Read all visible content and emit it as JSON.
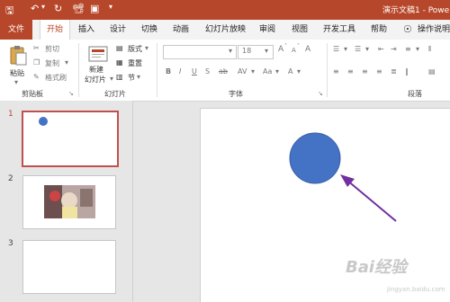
{
  "app": {
    "title": "演示文稿1 - Powe",
    "accent": "#b7472a"
  },
  "tabs": [
    {
      "label": "文件"
    },
    {
      "label": "开始"
    },
    {
      "label": "插入"
    },
    {
      "label": "设计"
    },
    {
      "label": "切换"
    },
    {
      "label": "动画"
    },
    {
      "label": "幻灯片放映"
    },
    {
      "label": "审阅"
    },
    {
      "label": "视图"
    },
    {
      "label": "开发工具"
    },
    {
      "label": "帮助"
    },
    {
      "label": "操作说明"
    }
  ],
  "ribbon": {
    "clipboard": {
      "paste": "粘贴",
      "cut": "剪切",
      "copy": "复制",
      "format_painter": "格式刷",
      "group_label": "剪贴板"
    },
    "slides": {
      "new_slide_line1": "新建",
      "new_slide_line2": "幻灯片",
      "layout": "版式",
      "reset": "重置",
      "section": "节",
      "group_label": "幻灯片"
    },
    "font": {
      "size": "18",
      "bold": "B",
      "italic": "I",
      "underline": "U",
      "strike": "S",
      "shadow": "ab",
      "spacing": "AV",
      "grow": "A",
      "shrink": "A",
      "case": "Aa",
      "clear": "A",
      "color": "A",
      "group_label": "字体"
    },
    "paragraph": {
      "group_label": "段落"
    }
  },
  "thumbnails": [
    {
      "number": "1"
    },
    {
      "number": "2"
    },
    {
      "number": "3"
    }
  ],
  "watermark": {
    "main": "Bai经验",
    "sub": "jingyan.baidu.com"
  },
  "colors": {
    "shape_fill": "#4472c4",
    "arrow": "#7030a0"
  }
}
